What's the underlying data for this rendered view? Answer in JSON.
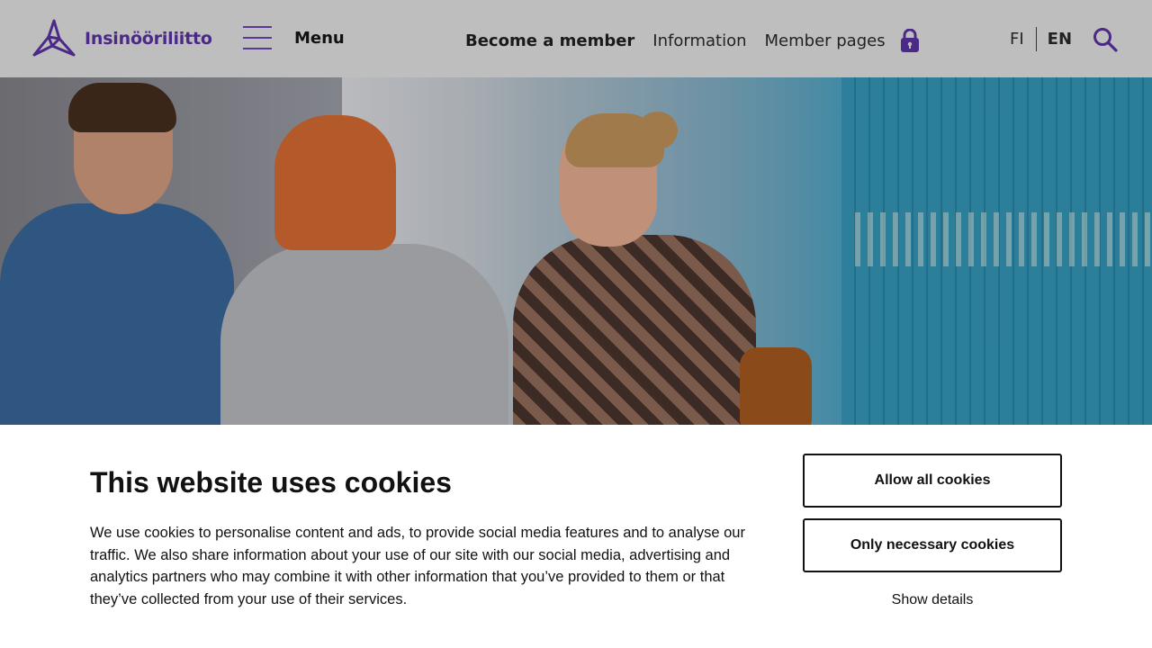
{
  "header": {
    "logo_text": "Insinööriliitto",
    "menu_label": "Menu",
    "nav": {
      "become_member": "Become a member",
      "information": "Information",
      "member_pages": "Member pages"
    },
    "lang": {
      "fi": "FI",
      "en": "EN"
    }
  },
  "colors": {
    "brand": "#4a2a86",
    "header_bg": "#bebebe"
  },
  "cookie": {
    "title": "This website uses cookies",
    "text": "We use cookies to personalise content and ads, to provide social media features and to analyse our traffic. We also share information about your use of our site with our social media, advertising and analytics partners who may combine it with other information that you’ve provided to them or that they’ve collected from your use of their services.",
    "allow_all": "Allow all cookies",
    "only_necessary": "Only necessary cookies",
    "show_details": "Show details"
  }
}
